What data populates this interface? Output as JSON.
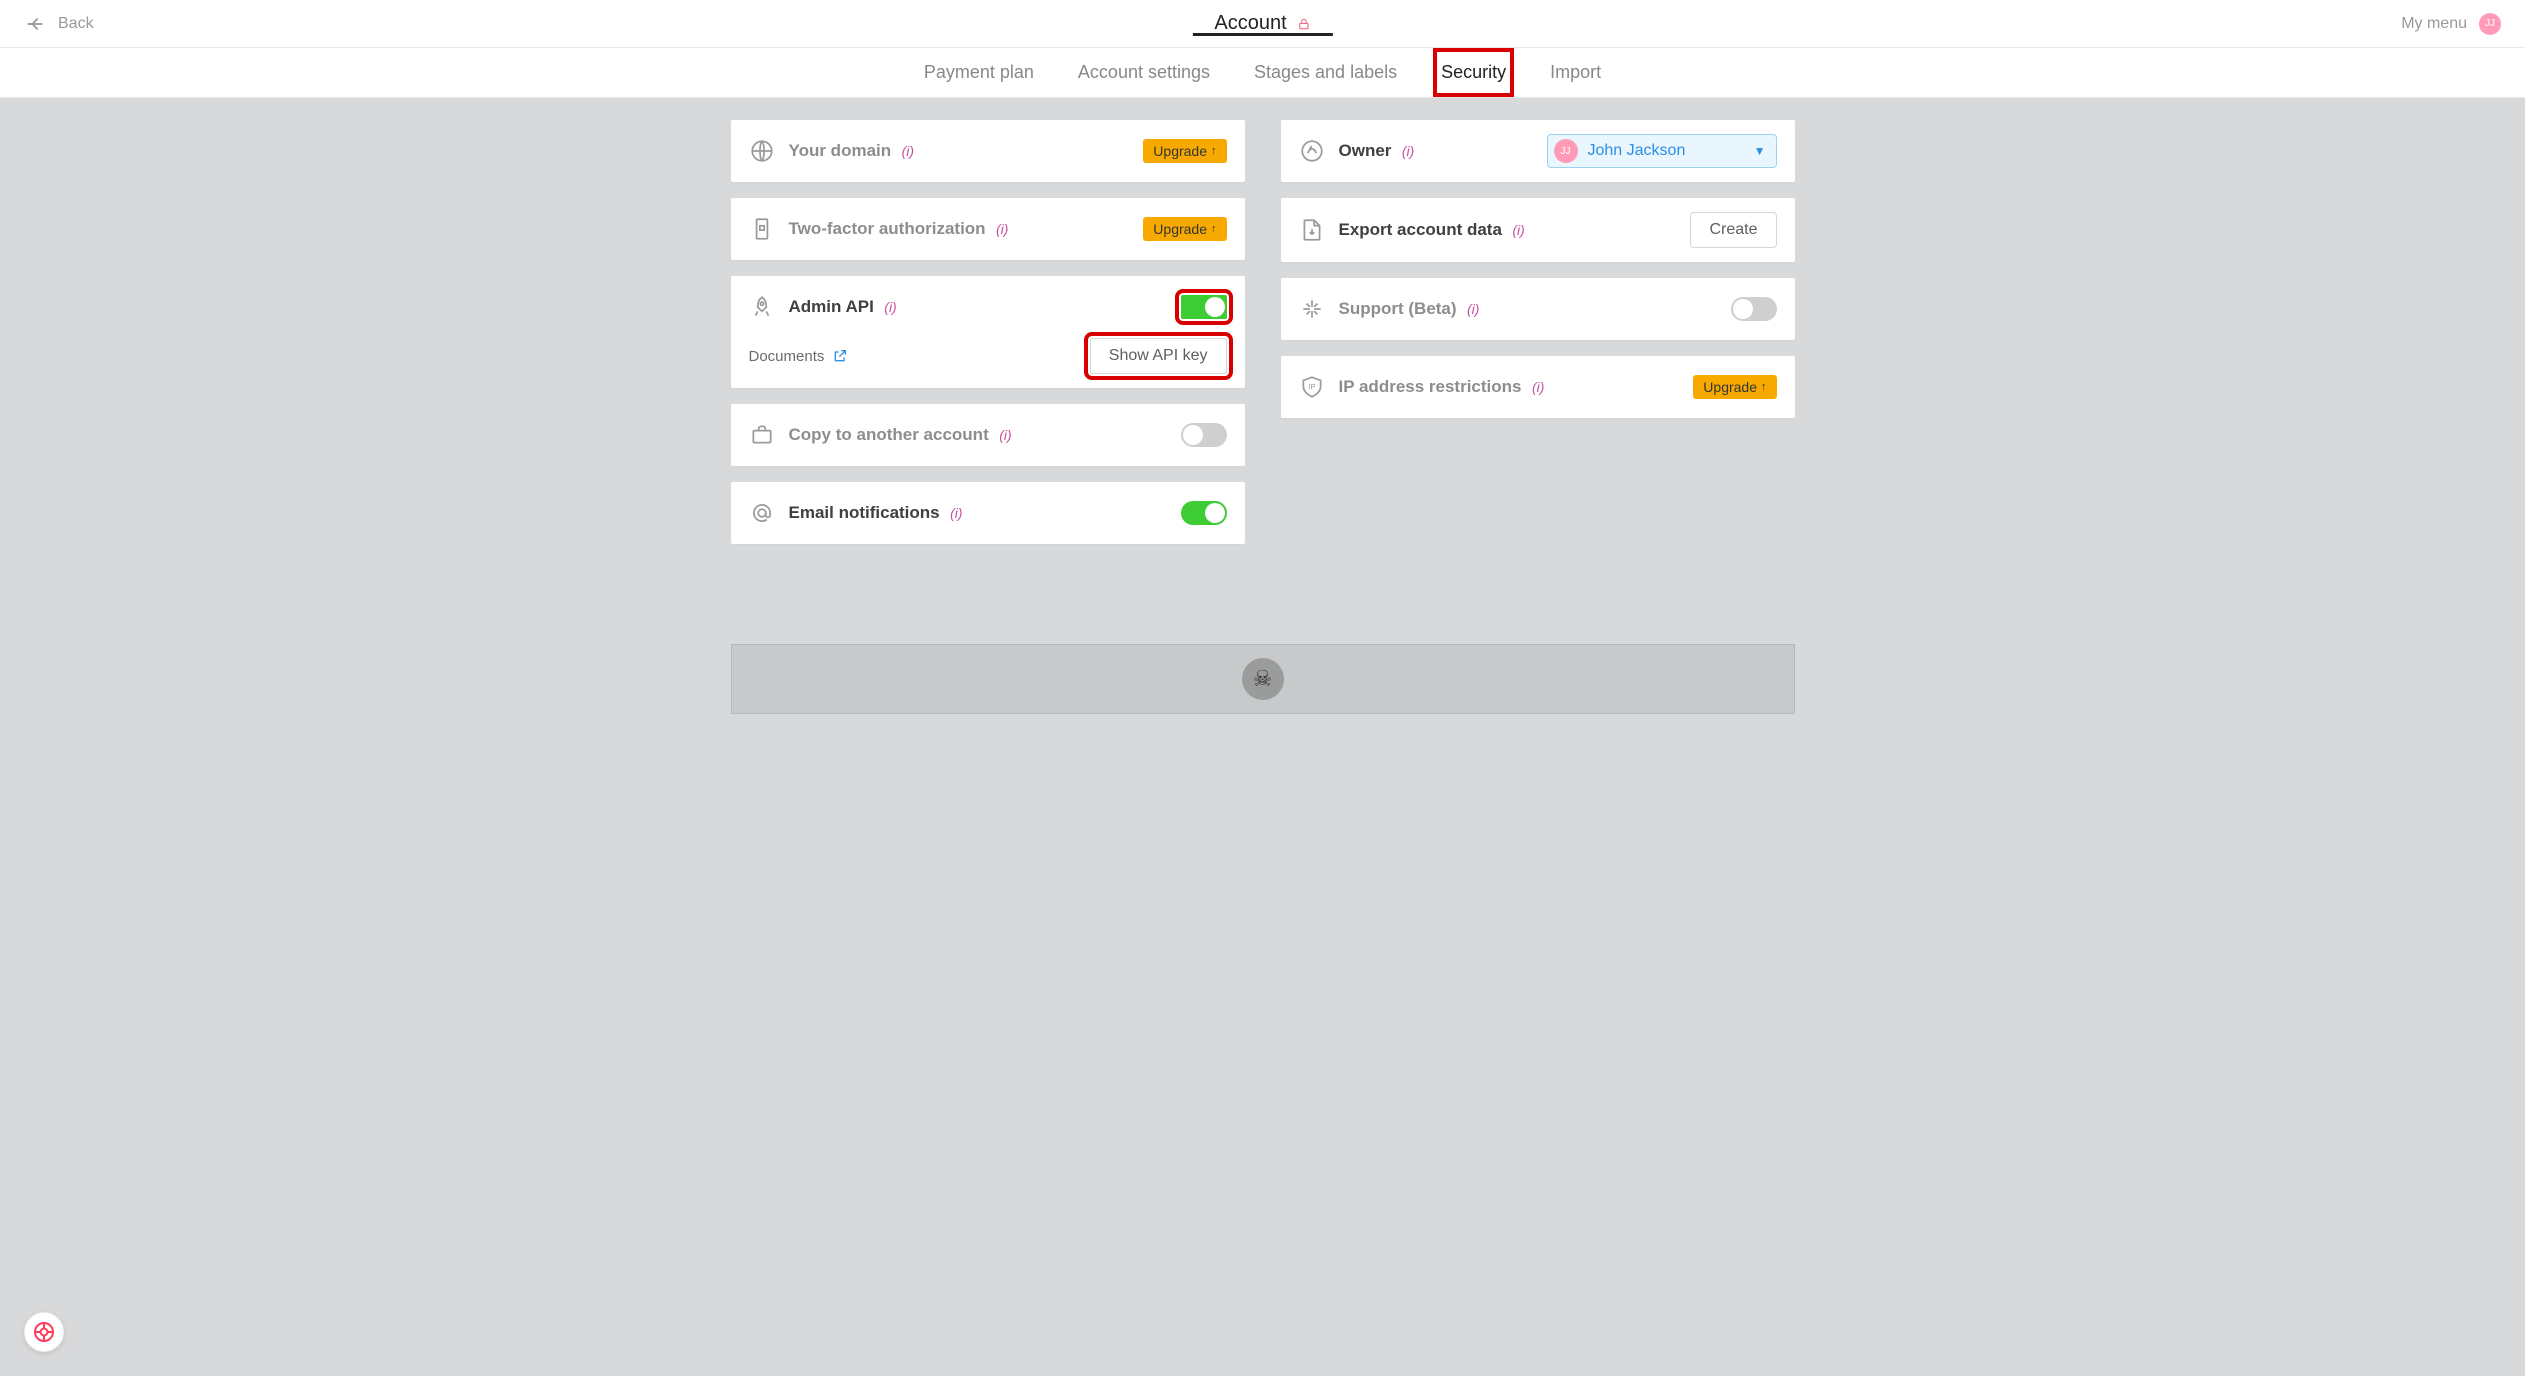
{
  "header": {
    "back_label": "Back",
    "title": "Account",
    "menu_label": "My menu",
    "avatar_initials": "JJ"
  },
  "tabs": {
    "payment_plan": "Payment plan",
    "account_settings": "Account settings",
    "stages_labels": "Stages and labels",
    "security": "Security",
    "import": "Import"
  },
  "left": {
    "your_domain": {
      "label": "Your domain",
      "action": "Upgrade"
    },
    "two_factor": {
      "label": "Two-factor authorization",
      "action": "Upgrade"
    },
    "admin_api": {
      "label": "Admin API",
      "documents_label": "Documents",
      "show_key": "Show API key"
    },
    "copy_account": {
      "label": "Copy to another account"
    },
    "email_notifications": {
      "label": "Email notifications"
    }
  },
  "right": {
    "owner": {
      "label": "Owner",
      "name": "John Jackson",
      "initials": "JJ"
    },
    "export": {
      "label": "Export account data",
      "action": "Create"
    },
    "support": {
      "label": "Support (Beta)"
    },
    "ip_restrict": {
      "label": "IP address restrictions",
      "action": "Upgrade"
    }
  },
  "info_marker": "(i)",
  "upgrade_arrow": "↑"
}
